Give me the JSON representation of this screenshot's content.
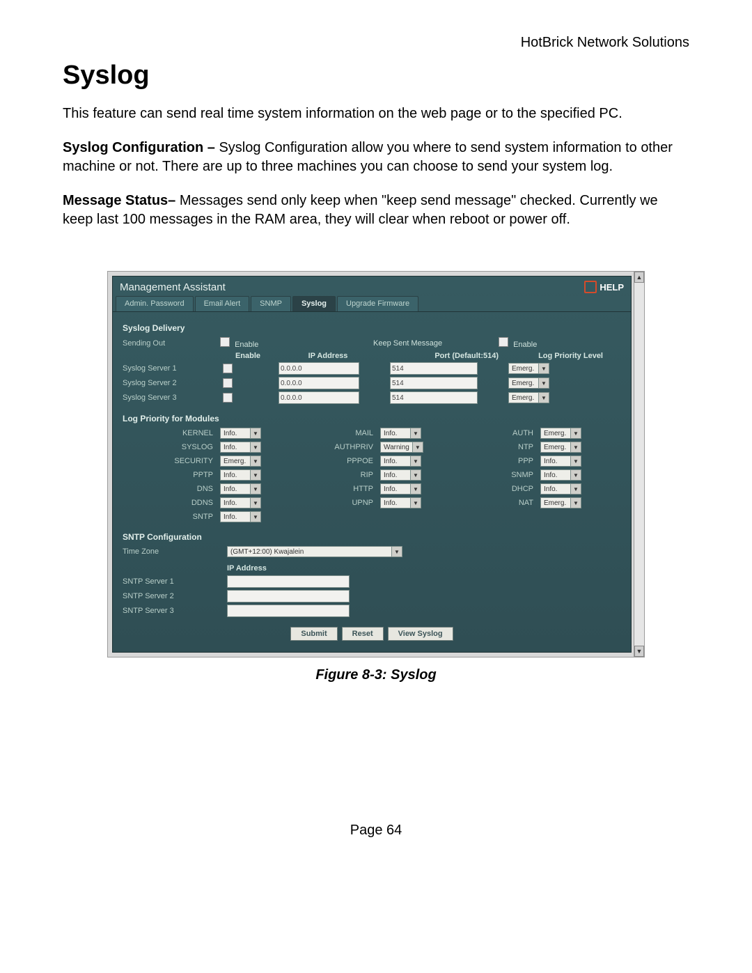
{
  "doc": {
    "header_right": "HotBrick Network Solutions",
    "title": "Syslog",
    "intro": "This feature can send real time system information on the web page or to the specified PC.",
    "para2_label": "Syslog Configuration – ",
    "para2_rest": "Syslog Configuration allow you where to send system information to other machine or not. There are up to three machines you can choose to send your system log.",
    "para3_label": " Message Status– ",
    "para3_rest": "Messages send only keep when \"keep send message\" checked. Currently we keep last 100 messages in the RAM area, they will clear when reboot or power off.",
    "caption": "Figure 8-3: Syslog",
    "footer": "Page 64"
  },
  "ui": {
    "panel_title": "Management Assistant",
    "help_label": "HELP",
    "tabs": [
      "Admin. Password",
      "Email Alert",
      "SNMP",
      "Syslog",
      "Upgrade Firmware"
    ],
    "active_tab_index": 3,
    "delivery": {
      "heading": "Syslog Delivery",
      "sending_out_label": "Sending Out",
      "enable_text": "Enable",
      "keep_sent_label": "Keep Sent Message",
      "cols": {
        "enable": "Enable",
        "ip": "IP Address",
        "port": "Port (Default:514)",
        "log": "Log Priority Level"
      },
      "servers": [
        {
          "name": "Syslog Server 1",
          "ip": "0.0.0.0",
          "port": "514",
          "level": "Emerg."
        },
        {
          "name": "Syslog Server 2",
          "ip": "0.0.0.0",
          "port": "514",
          "level": "Emerg."
        },
        {
          "name": "Syslog Server 3",
          "ip": "0.0.0.0",
          "port": "514",
          "level": "Emerg."
        }
      ]
    },
    "modules": {
      "heading": "Log Priority for Modules",
      "items": [
        {
          "l": "KERNEL",
          "v": "Info."
        },
        {
          "l": "MAIL",
          "v": "Info."
        },
        {
          "l": "AUTH",
          "v": "Emerg."
        },
        {
          "l": "SYSLOG",
          "v": "Info."
        },
        {
          "l": "AUTHPRIV",
          "v": "Warning"
        },
        {
          "l": "NTP",
          "v": "Emerg."
        },
        {
          "l": "SECURITY",
          "v": "Emerg."
        },
        {
          "l": "PPPOE",
          "v": "Info."
        },
        {
          "l": "PPP",
          "v": "Info."
        },
        {
          "l": "PPTP",
          "v": "Info."
        },
        {
          "l": "RIP",
          "v": "Info."
        },
        {
          "l": "SNMP",
          "v": "Info."
        },
        {
          "l": "DNS",
          "v": "Info."
        },
        {
          "l": "HTTP",
          "v": "Info."
        },
        {
          "l": "DHCP",
          "v": "Info."
        },
        {
          "l": "DDNS",
          "v": "Info."
        },
        {
          "l": "UPNP",
          "v": "Info."
        },
        {
          "l": "NAT",
          "v": "Emerg."
        },
        {
          "l": "SNTP",
          "v": "Info."
        }
      ]
    },
    "sntp": {
      "heading": "SNTP Configuration",
      "tz_label": "Time Zone",
      "tz_value": "(GMT+12:00) Kwajalein",
      "ip_heading": "IP Address",
      "servers": [
        "SNTP Server 1",
        "SNTP Server 2",
        "SNTP Server 3"
      ]
    },
    "buttons": {
      "submit": "Submit",
      "reset": "Reset",
      "view": "View Syslog"
    }
  }
}
